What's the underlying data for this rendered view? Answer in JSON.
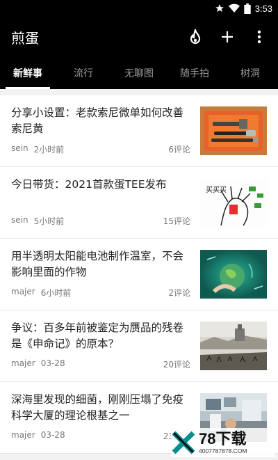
{
  "status_bar": {
    "time": "3:53"
  },
  "app_bar": {
    "title": "煎蛋"
  },
  "tabs": [
    {
      "label": "新鲜事",
      "active": true
    },
    {
      "label": "流行",
      "active": false
    },
    {
      "label": "无聊图",
      "active": false
    },
    {
      "label": "随手拍",
      "active": false
    },
    {
      "label": "树洞",
      "active": false
    }
  ],
  "posts": [
    {
      "title": "分享小设置：老款索尼微单如何改善索尼黄",
      "author": "sein",
      "time": "2小时前",
      "comments": "6评论"
    },
    {
      "title": "今日带货：2021首款蛋TEE发布",
      "author": "sein",
      "time": "5小时前",
      "comments": "15评论"
    },
    {
      "title": "用半透明太阳能电池制作温室，不会影响里面的作物",
      "author": "majer",
      "time": "6小时前",
      "comments": "2评论"
    },
    {
      "title": "争议：百多年前被鉴定为赝品的残卷是《申命记》的原本？",
      "author": "majer",
      "time": "03-28",
      "comments": "20评论"
    },
    {
      "title": "深海里发现的细菌，刚刚压塌了免疫科学大厦的理论根基之一",
      "author": "majer",
      "time": "03-28",
      "comments": "23评论"
    }
  ],
  "thumb_text": {
    "tee": "买买买"
  },
  "watermark": {
    "main": "78下载",
    "sub": "4007787878.COM"
  },
  "colors": {
    "bar": "#000000",
    "active_tab": "#ffffff",
    "inactive_tab": "#9a9a9a"
  }
}
